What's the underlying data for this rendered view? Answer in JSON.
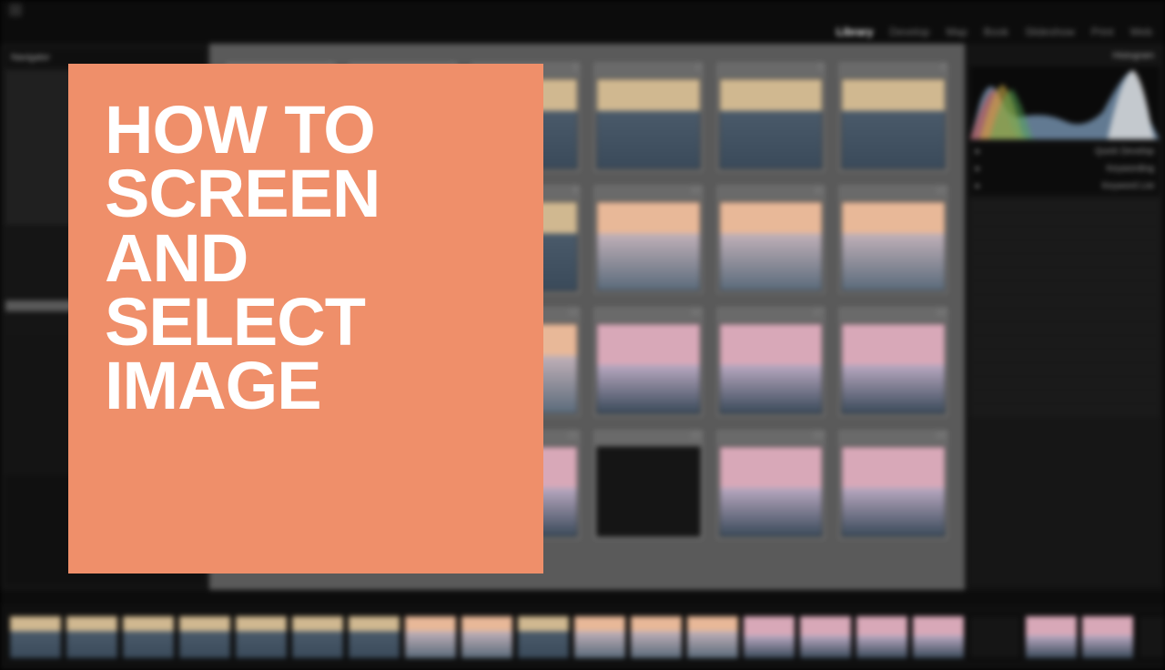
{
  "overlay": {
    "title": "HOW TO SCREEN AND SELECT IMAGE",
    "bg_color": "#ef8f6a",
    "text_color": "#ffffff"
  },
  "app": {
    "modules": [
      "Library",
      "Develop",
      "Map",
      "Book",
      "Slideshow",
      "Print",
      "Web"
    ],
    "active_module": "Library",
    "left": {
      "navigator_label": "Navigator"
    },
    "right": {
      "histogram_label": "Histogram",
      "panels": [
        "Quick Develop",
        "Keywording",
        "Keyword List"
      ]
    },
    "grid": {
      "numbers": [
        "1",
        "2",
        "3",
        "4",
        "5",
        "6",
        "7",
        "8",
        "9",
        "10",
        "11",
        "12",
        "13",
        "14",
        "15",
        "16",
        "17",
        "18",
        "19",
        "20",
        "21",
        "22",
        "23",
        "24"
      ],
      "styles": [
        "sky1",
        "sky1",
        "sky1",
        "sky1",
        "sky1",
        "sky1",
        "sky1",
        "sky1",
        "sky1",
        "sky2",
        "sky2",
        "sky2",
        "sky1",
        "sky2",
        "sky2",
        "sky3",
        "sky3",
        "sky3",
        "sky2",
        "sky3",
        "sky3",
        "dark",
        "sky3",
        "sky3"
      ]
    },
    "filmstrip": {
      "count": 21,
      "styles": [
        "sky1",
        "sky1",
        "sky1",
        "sky1",
        "sky1",
        "sky1",
        "sky1",
        "sky2",
        "sky2",
        "sky1",
        "sky2",
        "sky2",
        "sky2",
        "sky3",
        "sky3",
        "sky3",
        "sky3",
        "dark",
        "sky3",
        "sky3",
        "dark"
      ]
    }
  }
}
